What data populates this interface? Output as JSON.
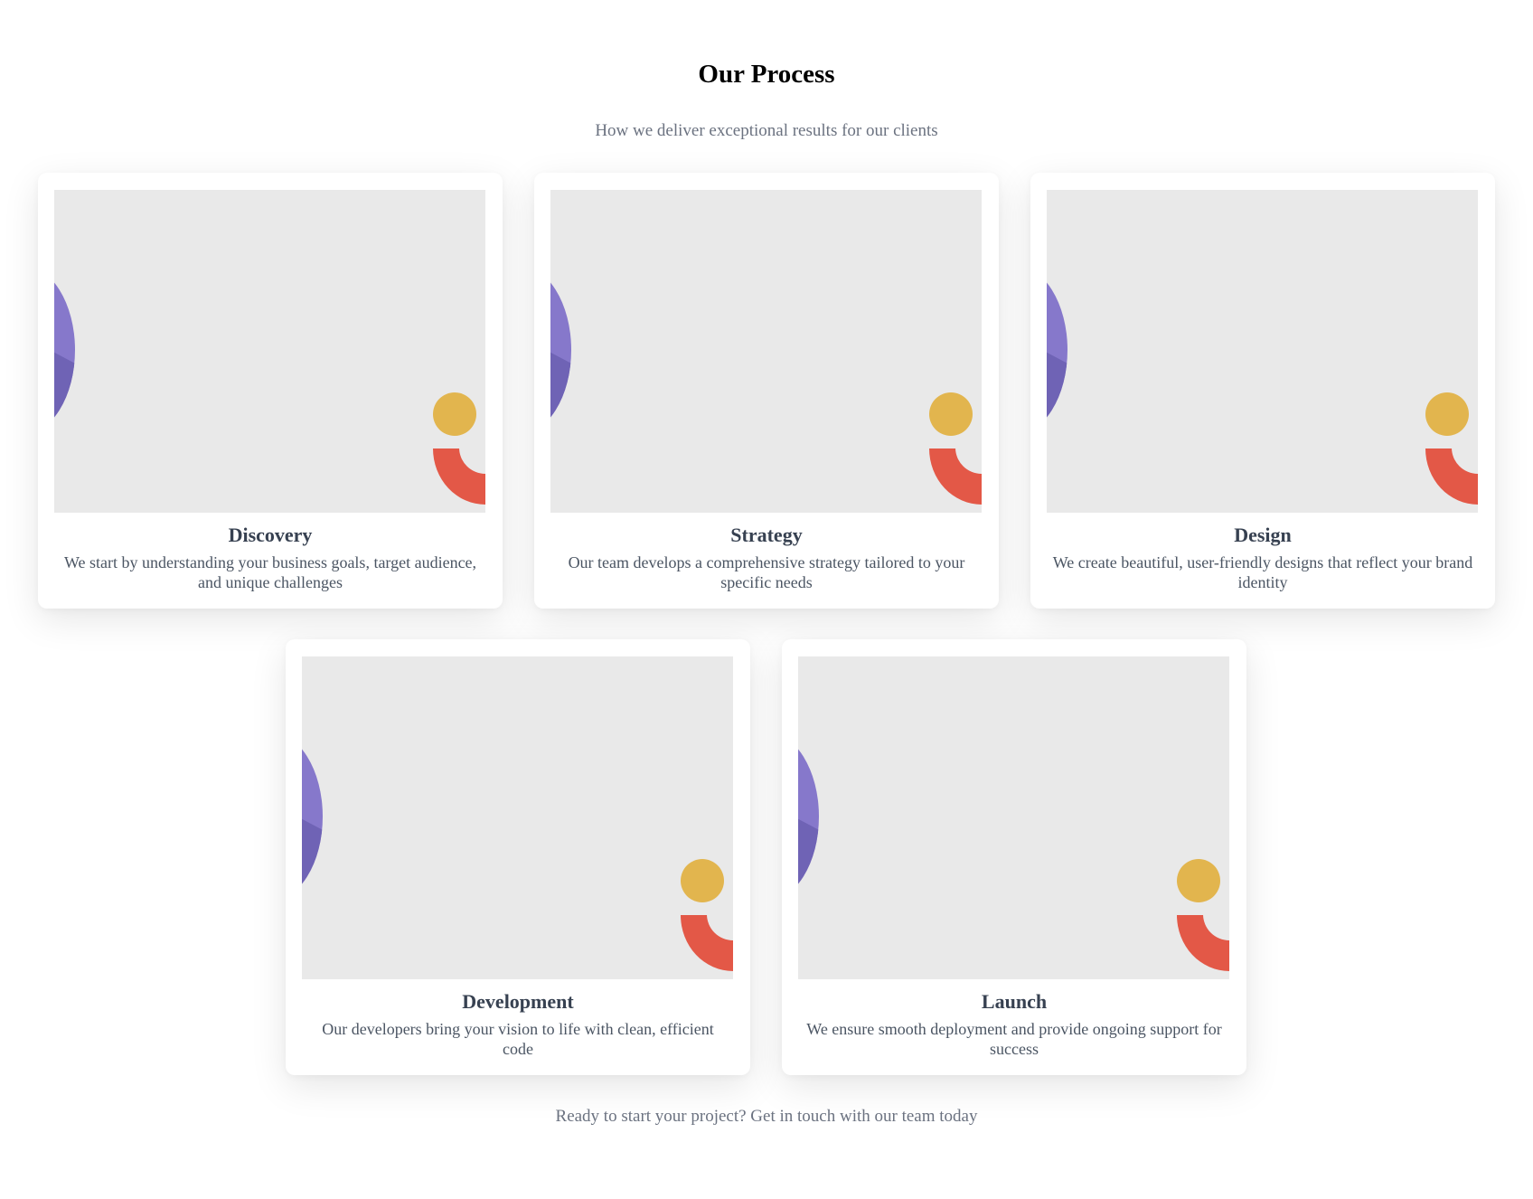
{
  "header": {
    "title": "Our Process",
    "subtitle": "How we deliver exceptional results for our clients"
  },
  "colors": {
    "purple": "#8678cb",
    "yellow": "#e2b54e",
    "red": "#e35847",
    "image_bg": "#e9e9e9"
  },
  "steps": [
    {
      "title": "Discovery",
      "description": "We start by understanding your business goals, target audience, and unique challenges"
    },
    {
      "title": "Strategy",
      "description": "Our team develops a comprehensive strategy tailored to your specific needs"
    },
    {
      "title": "Design",
      "description": "We create beautiful, user-friendly designs that reflect your brand identity"
    },
    {
      "title": "Development",
      "description": "Our developers bring your vision to life with clean, efficient code"
    },
    {
      "title": "Launch",
      "description": "We ensure smooth deployment and provide ongoing support for success"
    }
  ],
  "footer": {
    "text": "Ready to start your project? Get in touch with our team today"
  }
}
